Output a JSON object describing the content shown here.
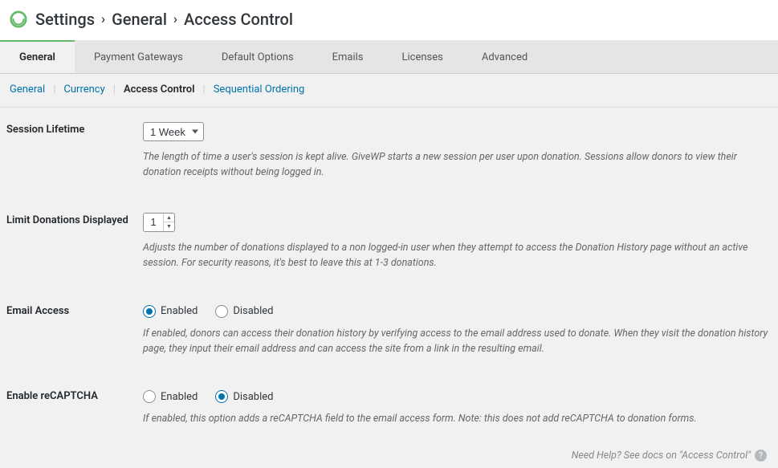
{
  "breadcrumb": {
    "root": "Settings",
    "section": "General",
    "page": "Access Control"
  },
  "tabs": [
    {
      "label": "General",
      "active": true
    },
    {
      "label": "Payment Gateways",
      "active": false
    },
    {
      "label": "Default Options",
      "active": false
    },
    {
      "label": "Emails",
      "active": false
    },
    {
      "label": "Licenses",
      "active": false
    },
    {
      "label": "Advanced",
      "active": false
    }
  ],
  "subtabs": [
    {
      "label": "General",
      "active": false
    },
    {
      "label": "Currency",
      "active": false
    },
    {
      "label": "Access Control",
      "active": true
    },
    {
      "label": "Sequential Ordering",
      "active": false
    }
  ],
  "fields": {
    "session_lifetime": {
      "label": "Session Lifetime",
      "value": "1 Week",
      "help": "The length of time a user's session is kept alive. GiveWP starts a new session per user upon donation. Sessions allow donors to view their donation receipts without being logged in."
    },
    "limit_donations": {
      "label": "Limit Donations Displayed",
      "value": "1",
      "help": "Adjusts the number of donations displayed to a non logged-in user when they attempt to access the Donation History page without an active session. For security reasons, it's best to leave this at 1-3 donations."
    },
    "email_access": {
      "label": "Email Access",
      "options": {
        "enabled": "Enabled",
        "disabled": "Disabled"
      },
      "value": "enabled",
      "help": "If enabled, donors can access their donation history by verifying access to the email address used to donate. When they visit the donation history page, they input their email address and can access the site from a link in the resulting email."
    },
    "recaptcha": {
      "label": "Enable reCAPTCHA",
      "options": {
        "enabled": "Enabled",
        "disabled": "Disabled"
      },
      "value": "disabled",
      "help": "If enabled, this option adds a reCAPTCHA field to the email access form. Note: this does not add reCAPTCHA to donation forms."
    }
  },
  "footer": {
    "text": "Need Help? See docs on \"Access Control\""
  }
}
